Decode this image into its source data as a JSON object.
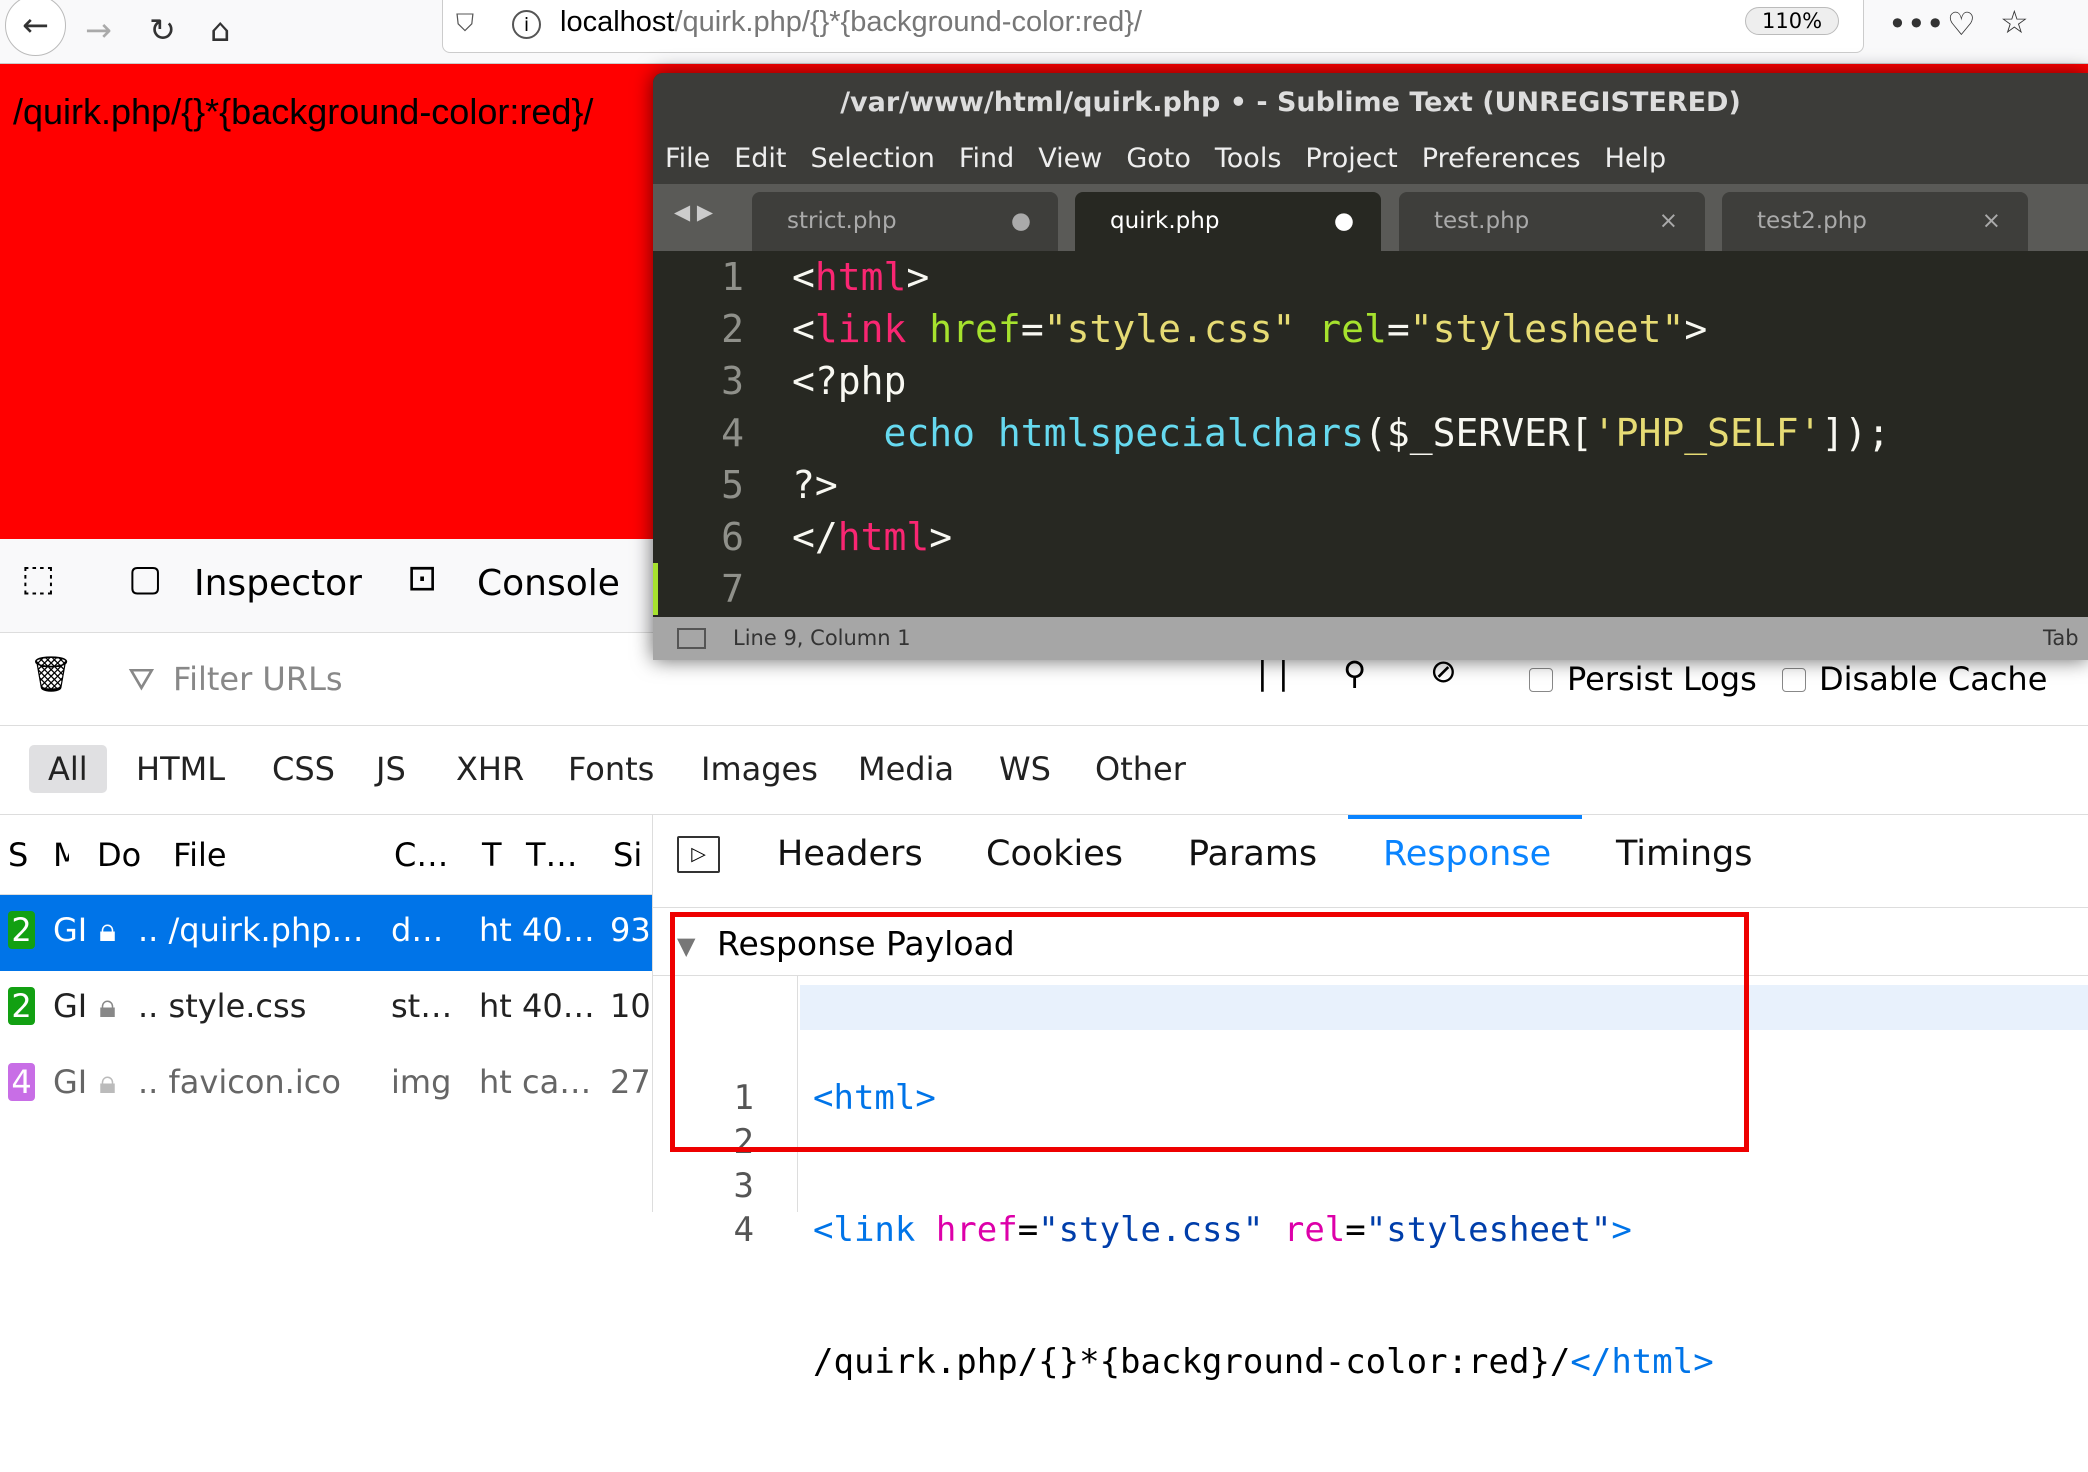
{
  "browser": {
    "url_host": "localhost",
    "url_path": "/quirk.php/{}*{background-color:red}/",
    "zoom": "110%"
  },
  "page": {
    "text": "/quirk.php/{}*{background-color:red}/",
    "background": "#ff0000"
  },
  "sublime": {
    "title": "/var/www/html/quirk.php • - Sublime Text (UNREGISTERED)",
    "menu": [
      "File",
      "Edit",
      "Selection",
      "Find",
      "View",
      "Goto",
      "Tools",
      "Project",
      "Preferences",
      "Help"
    ],
    "tabs": [
      {
        "label": "strict.php",
        "mark": "●"
      },
      {
        "label": "quirk.php",
        "mark": "●"
      },
      {
        "label": "test.php",
        "mark": "×"
      },
      {
        "label": "test2.php",
        "mark": "×"
      }
    ],
    "line_numbers": [
      "1",
      "2",
      "3",
      "4",
      "5",
      "6",
      "7"
    ],
    "status": "Line 9, Column 1",
    "status_right": "Tab"
  },
  "devtools": {
    "inspector": "Inspector",
    "console": "Console",
    "filter_placeholder": "Filter URLs",
    "persist_logs": "Persist Logs",
    "disable_cache": "Disable Cache",
    "filters": [
      "All",
      "HTML",
      "CSS",
      "JS",
      "XHR",
      "Fonts",
      "Images",
      "Media",
      "WS",
      "Other"
    ],
    "columns": [
      "S",
      "M",
      "Do",
      "File",
      "C…",
      "T",
      "T…",
      "Si"
    ],
    "rows": [
      {
        "status": "2",
        "method": "GI",
        "file": ".. /quirk.php…",
        "cause": "d…",
        "type": "ht 40…",
        "size": "93",
        "color": "#12a012"
      },
      {
        "status": "2",
        "method": "GI",
        "file": ".. style.css",
        "cause": "st…",
        "type": "ht 40…",
        "size": "10",
        "color": "#12a012"
      },
      {
        "status": "4",
        "method": "GI",
        "file": ".. favicon.ico",
        "cause": "img",
        "type": "ht ca…",
        "size": "27",
        "color": "#c86ee6"
      }
    ],
    "detail_tabs": [
      "Headers",
      "Cookies",
      "Params",
      "Response",
      "Timings"
    ],
    "payload_title": "Response Payload",
    "payload_lines": [
      "1",
      "2",
      "3",
      "4"
    ]
  }
}
